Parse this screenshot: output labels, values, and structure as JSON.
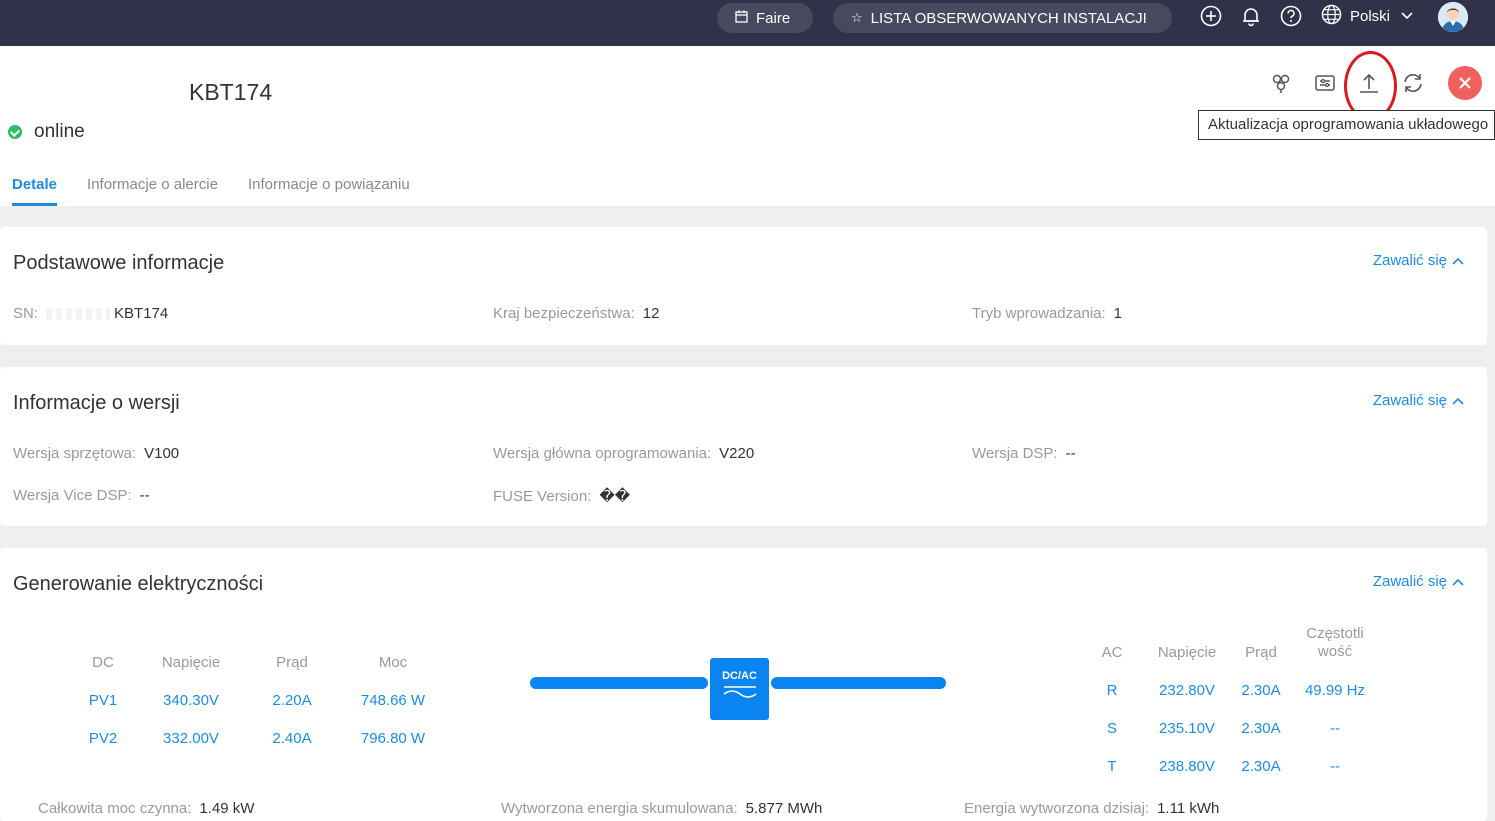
{
  "topbar": {
    "faire_label": "Faire",
    "watchlist_label": "LISTA OBSERWOWANYCH INSTALACJI",
    "language": "Polski"
  },
  "device": {
    "name": "KBT174",
    "status": "online"
  },
  "tooltip": "Aktualizacja oprogramowania układowego",
  "tabs": [
    "Detale",
    "Informacje o alercie",
    "Informacje o powiązaniu"
  ],
  "collapse_label": "Zawalić się",
  "basic": {
    "title": "Podstawowe informacje",
    "sn_label": "SN:",
    "sn_value": "KBT174",
    "safety_label": "Kraj bezpieczeństwa:",
    "safety_value": "12",
    "input_label": "Tryb wprowadzania:",
    "input_value": "1"
  },
  "version": {
    "title": "Informacje o wersji",
    "hw_label": "Wersja sprzętowa:",
    "hw_value": "V100",
    "fw_label": "Wersja główna oprogramowania:",
    "fw_value": "V220",
    "dsp_label": "Wersja DSP:",
    "dsp_value": "--",
    "vdsp_label": "Wersja Vice DSP:",
    "vdsp_value": "--",
    "fuse_label": "FUSE Version:",
    "fuse_value": "��"
  },
  "power": {
    "title": "Generowanie elektryczności",
    "dc_headers": [
      "DC",
      "Napięcie",
      "Prąd",
      "Moc"
    ],
    "dc_rows": [
      [
        "PV1",
        "340.30V",
        "2.20A",
        "748.66 W"
      ],
      [
        "PV2",
        "332.00V",
        "2.40A",
        "796.80 W"
      ]
    ],
    "converter_label": "DC/AC",
    "ac_headers": [
      "AC",
      "Napięcie",
      "Prąd",
      "Częstotli wość"
    ],
    "ac_rows": [
      [
        "R",
        "232.80V",
        "2.30A",
        "49.99 Hz"
      ],
      [
        "S",
        "235.10V",
        "2.30A",
        "--"
      ],
      [
        "T",
        "238.80V",
        "2.30A",
        "--"
      ]
    ],
    "total_power_label": "Całkowita moc czynna:",
    "total_power_value": "1.49 kW",
    "cumulative_label": "Wytworzona energia skumulowana:",
    "cumulative_value": "5.877 MWh",
    "today_label": "Energia wytworzona dzisiaj:",
    "today_value": "1.11 kWh"
  },
  "colors": {
    "topbar_bg": "#2f3248",
    "accent": "#1e8be0",
    "online": "#2fbd63",
    "close": "#f0605f",
    "highlight_ring": "#d71921"
  }
}
